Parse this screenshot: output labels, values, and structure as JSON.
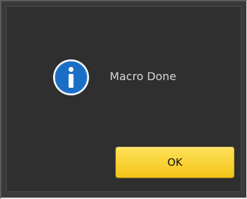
{
  "dialog": {
    "message": "Macro Done",
    "icon": "info-icon",
    "ok_label": "OK"
  },
  "colors": {
    "background": "#2f2f2f",
    "icon_blue": "#1a6fc4",
    "button_yellow": "#f6c82a",
    "text": "#d8d8d8"
  }
}
